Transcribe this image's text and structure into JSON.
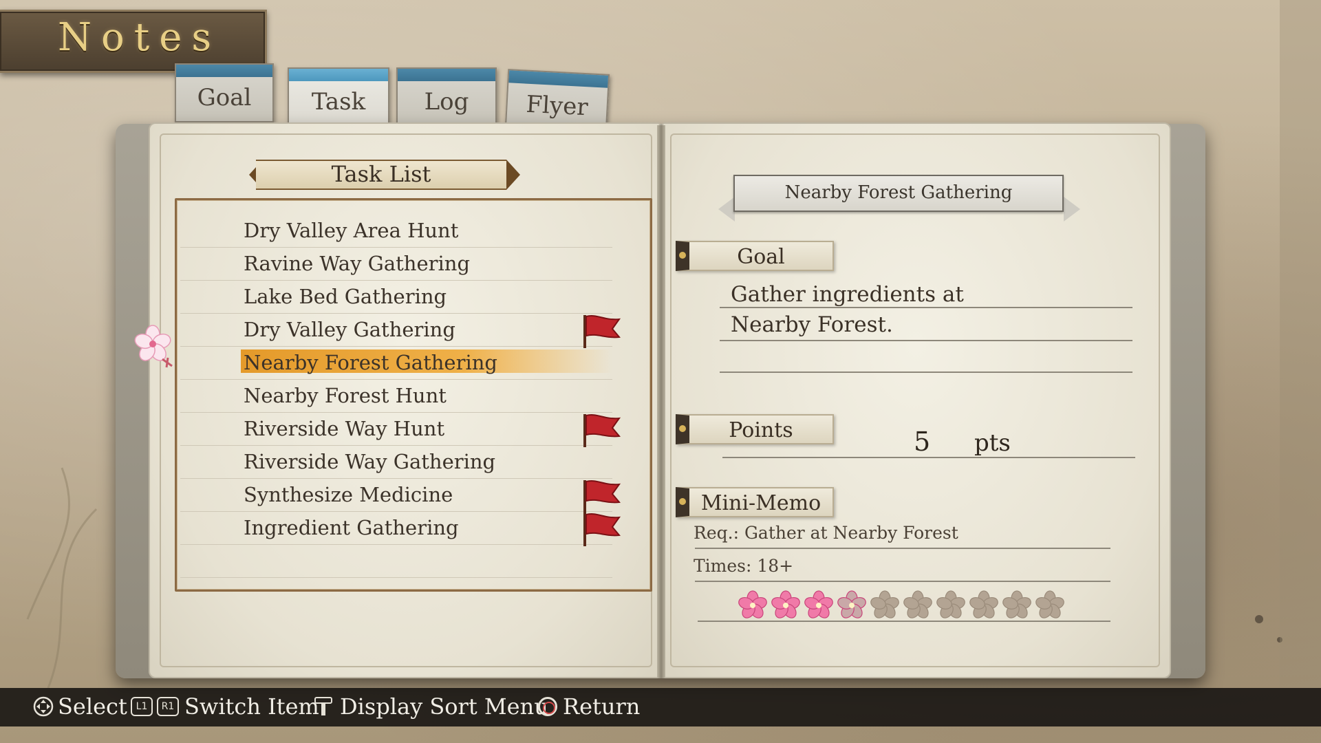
{
  "screen_title": "Notes",
  "tabs": [
    {
      "label": "Goal",
      "active": false
    },
    {
      "label": "Task",
      "active": true
    },
    {
      "label": "Log",
      "active": false
    },
    {
      "label": "Flyer",
      "active": false
    }
  ],
  "task_list": {
    "heading": "Task List",
    "items": [
      {
        "label": "Dry Valley Area Hunt",
        "flag": false,
        "selected": false
      },
      {
        "label": "Ravine Way Gathering",
        "flag": false,
        "selected": false
      },
      {
        "label": "Lake Bed Gathering",
        "flag": false,
        "selected": false
      },
      {
        "label": "Dry Valley Gathering",
        "flag": true,
        "selected": false
      },
      {
        "label": "Nearby Forest Gathering",
        "flag": false,
        "selected": true
      },
      {
        "label": "Nearby Forest Hunt",
        "flag": false,
        "selected": false
      },
      {
        "label": "Riverside Way Hunt",
        "flag": true,
        "selected": false
      },
      {
        "label": "Riverside Way Gathering",
        "flag": false,
        "selected": false
      },
      {
        "label": "Synthesize Medicine",
        "flag": true,
        "selected": false
      },
      {
        "label": "Ingredient Gathering",
        "flag": true,
        "selected": false
      }
    ]
  },
  "detail": {
    "title": "Nearby Forest Gathering",
    "goal_label": "Goal",
    "goal_lines": [
      "Gather ingredients at",
      "Nearby Forest."
    ],
    "points_label": "Points",
    "points_value": "5",
    "points_unit": "pts",
    "memo_label": "Mini-Memo",
    "memo_req": "Req.: Gather at Nearby Forest",
    "memo_times": "Times: 18+",
    "progress": {
      "filled": 3,
      "partial": 1,
      "total": 10
    }
  },
  "button_hints": {
    "select": "Select",
    "l1": "L1",
    "r1": "R1",
    "switch_item": "Switch Item",
    "sort_menu": "Display Sort Menu",
    "return": "Return"
  },
  "colors": {
    "tab_accent": "#4d98be",
    "highlight": "#efb048",
    "flag_red": "#c0252b",
    "flower_pink": "#f07aa8"
  }
}
